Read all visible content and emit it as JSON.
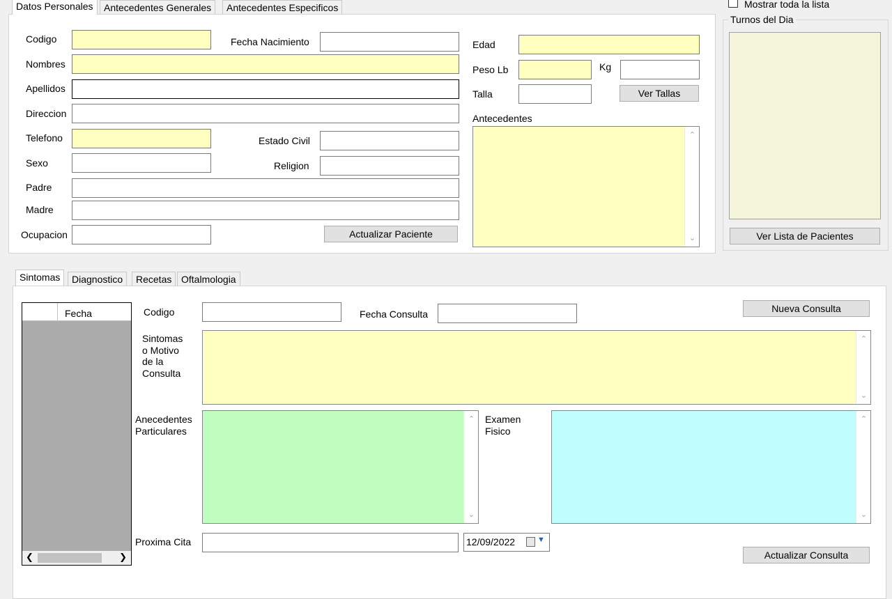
{
  "top_tabs": [
    "Datos Personales",
    "Antecedentes  Generales",
    "Antecedentes Especificos"
  ],
  "patient": {
    "codigo_label": "Codigo",
    "fecha_nacimiento_label": "Fecha Nacimiento",
    "nombres_label": "Nombres",
    "apellidos_label": "Apellidos",
    "direccion_label": "Direccion",
    "telefono_label": "Telefono",
    "estado_civil_label": "Estado Civil",
    "sexo_label": "Sexo",
    "religion_label": "Religion",
    "padre_label": "Padre",
    "madre_label": "Madre",
    "ocupacion_label": "Ocupacion",
    "actualizar_paciente_label": "Actualizar Paciente",
    "edad_label": "Edad",
    "peso_label": "Peso Lb",
    "kg_label": "Kg",
    "talla_label": "Talla",
    "ver_tallas_label": "Ver Tallas",
    "antecedentes_label": "Antecedentes"
  },
  "right_panel": {
    "mostrar_label": "Mostrar toda la lista",
    "turnos_label": "Turnos del Dia",
    "ver_lista_label": "Ver Lista de Pacientes"
  },
  "bottom_tabs": [
    "Sintomas",
    "Diagnostico",
    "Recetas",
    "Oftalmologia"
  ],
  "consulta": {
    "grid_header": "Fecha",
    "codigo_label": "Codigo",
    "fecha_consulta_label": "Fecha Consulta",
    "nueva_consulta_label": "Nueva Consulta",
    "sintomas_label": [
      "Sintomas",
      "o Motivo",
      "de la",
      "Consulta"
    ],
    "anecedentes_label": [
      "Anecedentes",
      "Particulares"
    ],
    "examen_label": [
      "Examen",
      "Fisico"
    ],
    "proxima_cita_label": "Proxima Cita",
    "proxima_cita_date": "12/09/2022",
    "actualizar_consulta_label": "Actualizar Consulta"
  },
  "colors": {
    "required_field": "#ffffc0",
    "list_bg": "#f5f5dc",
    "grid_bg": "#ababab",
    "anecedentes_bg": "#c0ffc0",
    "examen_bg": "#c0ffff"
  }
}
